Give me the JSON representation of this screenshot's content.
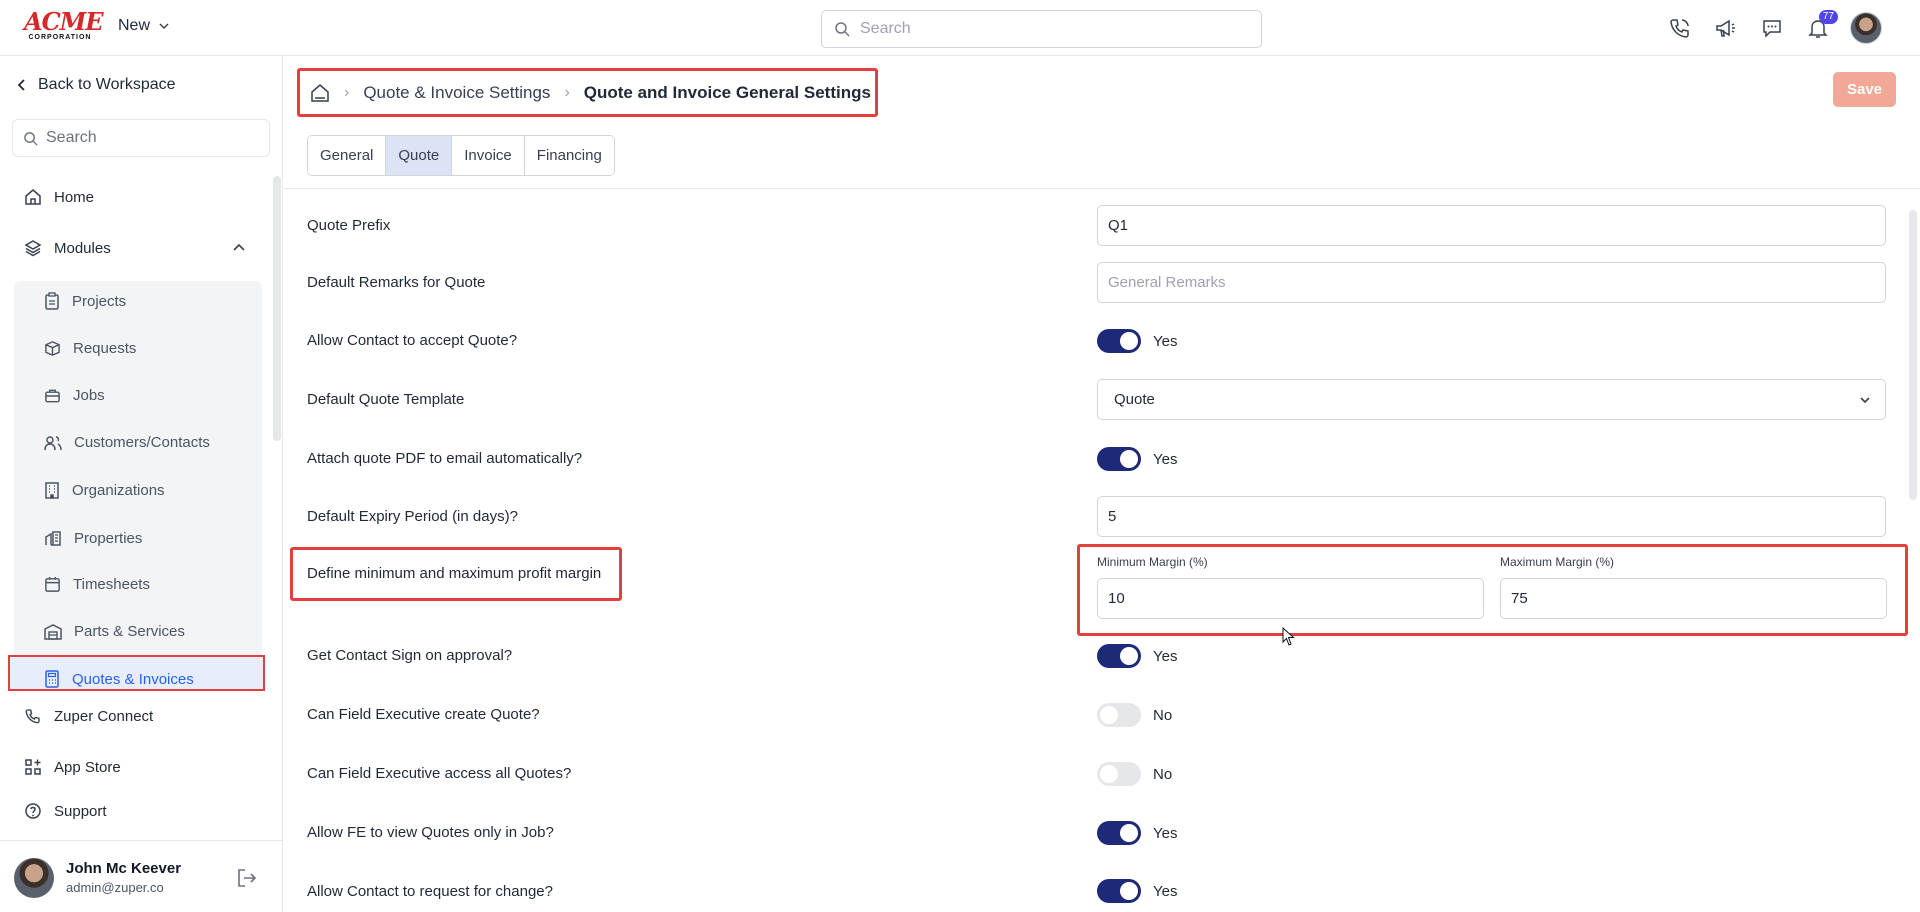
{
  "brand": {
    "logo_main": "ACME",
    "logo_sub": "CORPORATION"
  },
  "topbar": {
    "new_label": "New",
    "search_placeholder": "Search",
    "notification_count": "77",
    "icons": [
      "phone-icon",
      "megaphone-icon",
      "chat-icon",
      "bell-icon"
    ]
  },
  "sidebar": {
    "back_label": "Back to Workspace",
    "search_placeholder": "Search",
    "home": "Home",
    "modules": "Modules",
    "module_items": [
      {
        "label": "Projects",
        "icon": "clipboard-icon"
      },
      {
        "label": "Requests",
        "icon": "box-icon"
      },
      {
        "label": "Jobs",
        "icon": "briefcase-icon"
      },
      {
        "label": "Customers/Contacts",
        "icon": "users-icon"
      },
      {
        "label": "Organizations",
        "icon": "building-icon"
      },
      {
        "label": "Properties",
        "icon": "property-icon"
      },
      {
        "label": "Timesheets",
        "icon": "calendar-icon"
      },
      {
        "label": "Parts & Services",
        "icon": "warehouse-icon"
      },
      {
        "label": "Quotes & Invoices",
        "icon": "calculator-icon"
      }
    ],
    "zuper_connect": "Zuper Connect",
    "app_store": "App Store",
    "support": "Support",
    "user": {
      "name": "John Mc Keever",
      "email": "admin@zuper.co"
    }
  },
  "breadcrumb": {
    "level1": "Quote & Invoice Settings",
    "current": "Quote and Invoice General Settings"
  },
  "save_label": "Save",
  "tabs": [
    "General",
    "Quote",
    "Invoice",
    "Financing"
  ],
  "active_tab": "Quote",
  "settings": {
    "quote_prefix": {
      "label": "Quote Prefix",
      "value": "Q1"
    },
    "default_remarks": {
      "label": "Default Remarks for Quote",
      "placeholder": "General Remarks"
    },
    "allow_accept": {
      "label": "Allow Contact to accept Quote?",
      "state": "Yes"
    },
    "default_template": {
      "label": "Default Quote Template",
      "value": "Quote"
    },
    "attach_pdf": {
      "label": "Attach quote PDF to email automatically?",
      "state": "Yes"
    },
    "expiry": {
      "label": "Default Expiry Period (in days)?",
      "value": "5"
    },
    "margin": {
      "label": "Define minimum and maximum profit margin",
      "min_label": "Minimum Margin (%)",
      "min_value": "10",
      "max_label": "Maximum Margin (%)",
      "max_value": "75"
    },
    "contact_sign": {
      "label": "Get Contact Sign on approval?",
      "state": "Yes"
    },
    "fe_create": {
      "label": "Can Field Executive create Quote?",
      "state": "No"
    },
    "fe_access": {
      "label": "Can Field Executive access all Quotes?",
      "state": "No"
    },
    "fe_view_job": {
      "label": "Allow FE to view Quotes only in Job?",
      "state": "Yes"
    },
    "request_change": {
      "label": "Allow Contact to request for change?",
      "state": "Yes"
    }
  },
  "colors": {
    "accent": "#1e2a78",
    "highlight": "#e53e3e",
    "save": "#f2a897",
    "active_link": "#2563eb"
  }
}
